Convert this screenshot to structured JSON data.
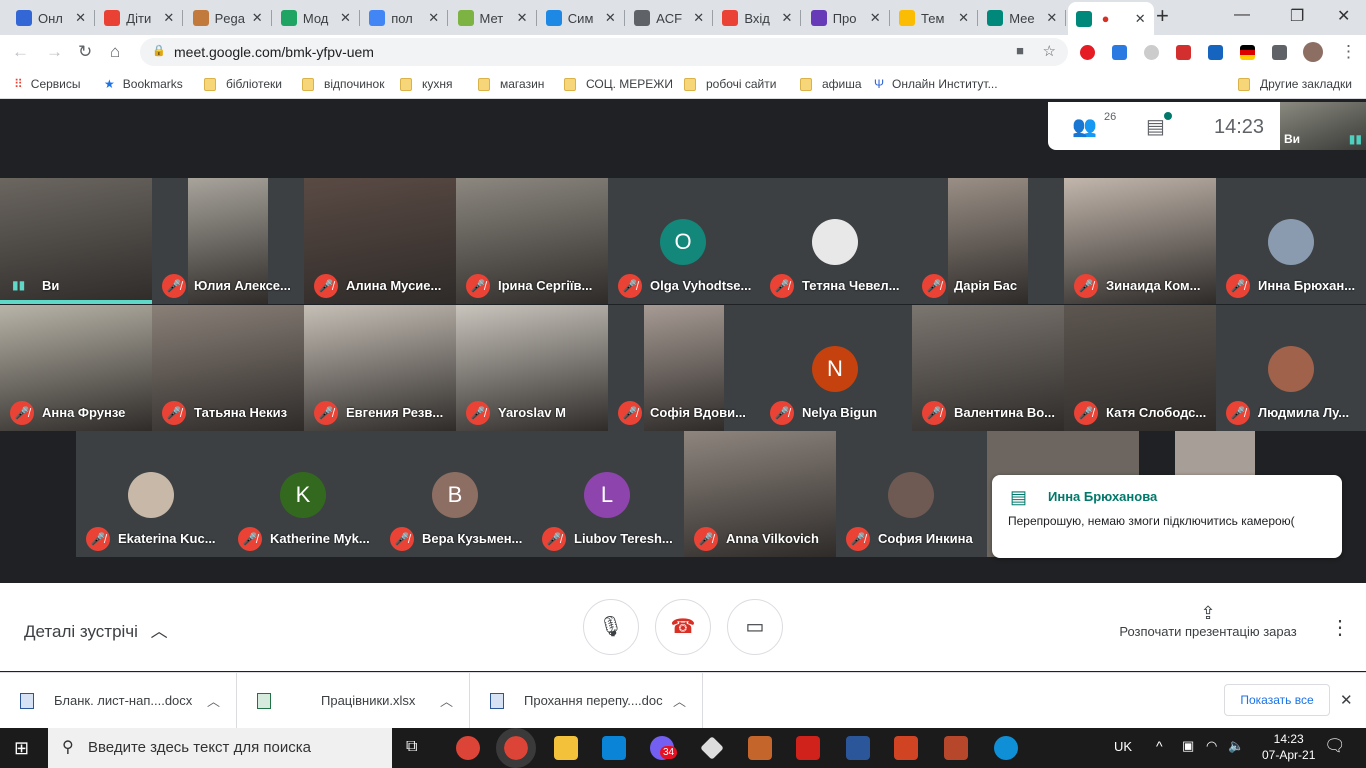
{
  "browser": {
    "tabs": [
      {
        "title": "Онл",
        "color": "#3367d6"
      },
      {
        "title": "Діти",
        "color": "#e94235"
      },
      {
        "title": "Pega",
        "color": "#c27a3c"
      },
      {
        "title": "Мод",
        "color": "#1fa463"
      },
      {
        "title": "пол",
        "color": "#4285f4"
      },
      {
        "title": "Мет",
        "color": "#7cb342"
      },
      {
        "title": "Сим",
        "color": "#1e88e5"
      },
      {
        "title": "ACF",
        "color": "#5f6368"
      },
      {
        "title": "Вхід",
        "color": "#ea4335"
      },
      {
        "title": "Про",
        "color": "#673ab7"
      },
      {
        "title": "Тем",
        "color": "#fbbc04"
      },
      {
        "title": "Mee",
        "color": "#00897b"
      },
      {
        "title": "",
        "color": "#00897b",
        "active": true
      }
    ],
    "url": "meet.google.com/bmk-yfpv-uem",
    "bookmarks": [
      {
        "label": "Сервисы",
        "icon": "apps-icon"
      },
      {
        "label": "Bookmarks",
        "icon": "star-icon"
      },
      {
        "label": "бібліотеки",
        "icon": "folder-icon"
      },
      {
        "label": "відпочинок",
        "icon": "folder-icon"
      },
      {
        "label": "кухня",
        "icon": "folder-icon"
      },
      {
        "label": "магазин",
        "icon": "folder-icon"
      },
      {
        "label": "СОЦ. МЕРЕЖИ",
        "icon": "folder-icon"
      },
      {
        "label": "робочі сайти",
        "icon": "folder-icon"
      },
      {
        "label": "афиша",
        "icon": "folder-icon"
      },
      {
        "label": "Онлайн Институт...",
        "icon": "site-icon"
      }
    ],
    "other_bookmarks": "Другие закладки"
  },
  "meet": {
    "participants_count": "26",
    "clock": "14:23",
    "self_label": "Ви",
    "tiles": [
      {
        "name": "Ви",
        "type": "video",
        "self": true,
        "bg": "#6b6660"
      },
      {
        "name": "Юлия Алексе...",
        "type": "video",
        "bg": "#a8a49c",
        "narrow": true
      },
      {
        "name": "Алина Мусие...",
        "type": "video",
        "bg": "#5a4a44"
      },
      {
        "name": "Ірина Сергіїв...",
        "type": "video",
        "bg": "#8c8880"
      },
      {
        "name": "Olga Vyhodtse...",
        "type": "avatar",
        "letter": "O",
        "color": "#12877a"
      },
      {
        "name": "Тетяна Чевел...",
        "type": "avatar",
        "letter": "",
        "color": "#e8e8e8"
      },
      {
        "name": "Дарія Бас",
        "type": "video",
        "bg": "#9a8f86",
        "narrow": true
      },
      {
        "name": "Зинаида Ком...",
        "type": "video",
        "bg": "#c2b6ac"
      },
      {
        "name": "Инна Брюхан...",
        "type": "avatar",
        "letter": "",
        "color": "#8a9bb0"
      },
      {
        "name": "Анна Фрунзе",
        "type": "video",
        "bg": "#b8b4a8"
      },
      {
        "name": "Татьяна Некиз",
        "type": "video",
        "bg": "#8a8078"
      },
      {
        "name": "Евгения Резв...",
        "type": "video",
        "bg": "#c6bfb6"
      },
      {
        "name": "Yaroslav M",
        "type": "video",
        "bg": "#c9c4bc"
      },
      {
        "name": "Софія Вдови...",
        "type": "video",
        "bg": "#a79b94",
        "narrow": true
      },
      {
        "name": "Nelya Bigun",
        "type": "avatar",
        "letter": "N",
        "color": "#c5410e"
      },
      {
        "name": "Валентина Во...",
        "type": "video",
        "bg": "#7c7670"
      },
      {
        "name": "Катя Слободс...",
        "type": "video",
        "bg": "#5d5650"
      },
      {
        "name": "Людмила Лу...",
        "type": "avatar",
        "letter": "",
        "color": "#a0624a"
      },
      {
        "name": "Ekaterina Kuc...",
        "type": "avatar",
        "letter": "",
        "color": "#c8b8a8"
      },
      {
        "name": "Katherine Myk...",
        "type": "avatar",
        "letter": "K",
        "color": "#33691e"
      },
      {
        "name": "Вера Кузьмен...",
        "type": "avatar",
        "letter": "B",
        "color": "#8d6e63"
      },
      {
        "name": "Liubov Teresh...",
        "type": "avatar",
        "letter": "L",
        "color": "#8e44ad"
      },
      {
        "name": "Anna Vilkovich",
        "type": "video",
        "bg": "#8e857e"
      },
      {
        "name": "София Инкина",
        "type": "avatar",
        "letter": "",
        "color": "#6e5a52"
      }
    ],
    "chat_popup": {
      "sender": "Инна Брюханова",
      "message": "Перепрошую, немаю змоги  підключитись камерою("
    },
    "meeting_details": "Деталі зустрічі",
    "present_now": "Розпочати презентацію зараз"
  },
  "downloads": {
    "items": [
      {
        "name": "Бланк. лист-нап....docx",
        "type": "word"
      },
      {
        "name": "Працівники.xlsx",
        "type": "excel"
      },
      {
        "name": "Прохання перепу....doc",
        "type": "word"
      }
    ],
    "show_all": "Показать все"
  },
  "taskbar": {
    "search_placeholder": "Введите здесь текст для поиска",
    "viber_badge": "34",
    "lang": "UK",
    "time": "14:23",
    "date": "07-Apr-21"
  }
}
